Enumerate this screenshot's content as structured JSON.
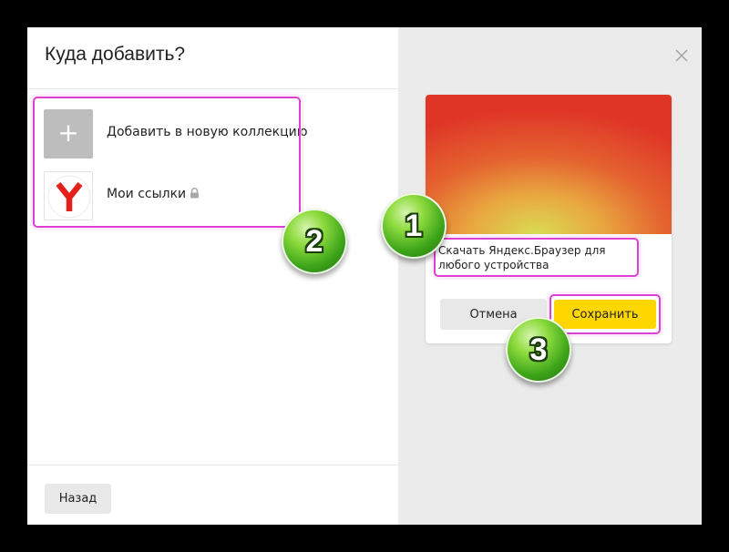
{
  "dialog": {
    "title": "Куда добавить?",
    "collections": [
      {
        "label": "Добавить в новую коллекцию",
        "icon": "plus-icon"
      },
      {
        "label": "Мои ссылки",
        "icon": "yandex-logo",
        "private_icon": "lock-icon"
      }
    ],
    "back_label": "Назад",
    "close_icon": "close-icon"
  },
  "card": {
    "title_value": "Скачать Яндекс.Браузер для любого устройства",
    "cancel_label": "Отмена",
    "save_label": "Сохранить"
  },
  "markers": [
    {
      "number": "1"
    },
    {
      "number": "2"
    },
    {
      "number": "3"
    }
  ],
  "colors": {
    "highlight": "#e03fd4",
    "save_accent": "#ffd700",
    "marker_green": "#3ea51a",
    "yandex_red": "#e3201b"
  }
}
